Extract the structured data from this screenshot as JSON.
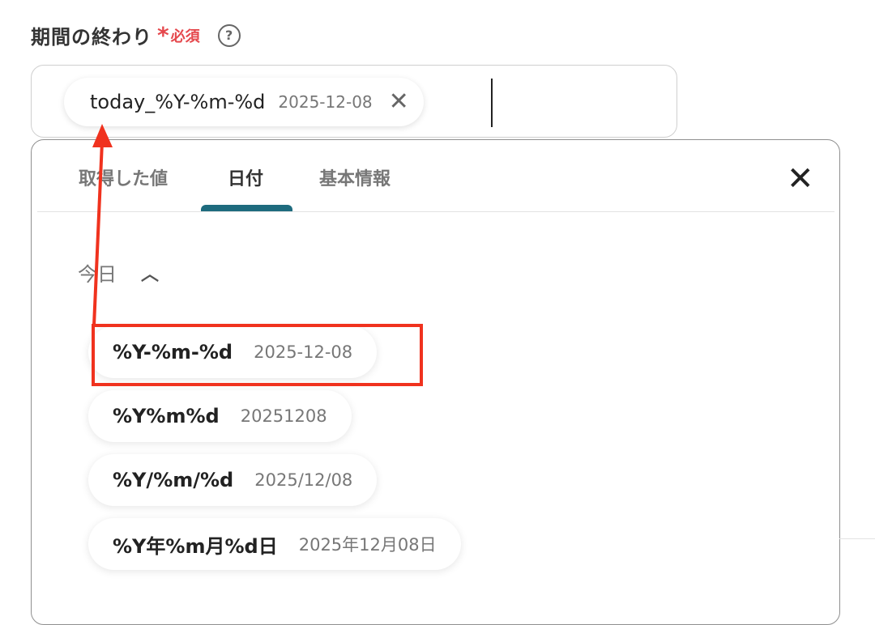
{
  "field": {
    "label": "期間の終わり",
    "required_mark": "*",
    "required_text": "必須",
    "help_icon": "question-circle-icon",
    "token": {
      "label": "today_%Y-%m-%d",
      "value": "2025-12-08",
      "close_icon": "close-icon"
    }
  },
  "panel": {
    "tabs": [
      {
        "label": "取得した値",
        "active": false
      },
      {
        "label": "日付",
        "active": true
      },
      {
        "label": "基本情報",
        "active": false
      }
    ],
    "close_icon": "close-icon",
    "accent_color": "#1e6b7e",
    "section": {
      "title": "今日",
      "chevron": "chevron-up-icon"
    },
    "options": [
      {
        "label": "%Y-%m-%d",
        "value": "2025-12-08"
      },
      {
        "label": "%Y%m%d",
        "value": "20251208"
      },
      {
        "label": "%Y/%m/%d",
        "value": "2025/12/08"
      },
      {
        "label": "%Y年%m月%d日",
        "value": "2025年12月08日"
      }
    ]
  },
  "annotation": {
    "color": "#f0321e"
  }
}
